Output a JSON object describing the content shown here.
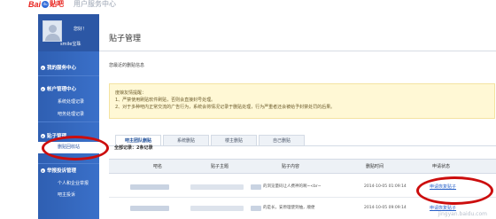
{
  "header": {
    "logo_bai": "Bai",
    "logo_paw": "du",
    "logo_tieba": "贴吧",
    "title": "用户服务中心"
  },
  "sidebar": {
    "hello": "您好！",
    "username": "smile宝珠",
    "sections": [
      {
        "label": "我的服务中心",
        "items": []
      },
      {
        "label": "帐户管理中心",
        "items": [
          "系统处理记录",
          "吧务处理记录"
        ]
      },
      {
        "label": "贴子管理",
        "items": [
          "删贴回收站"
        ]
      },
      {
        "label": "举报投诉管理",
        "items": [
          "个人和企业举报",
          "吧主投诉"
        ]
      }
    ],
    "active_item": "删贴回收站"
  },
  "main": {
    "title": "贴子管理",
    "subhead": "您最近的删贴信息",
    "notice": {
      "heading": "度娘友情提醒：",
      "line1": "1、严禁使用刷贴软件刷贴，否则会直接封号处理。",
      "line2": "2、对于多种吧内正常交流的广告行为，系统会将情况记录于删贴处理，行为严重者还会被给予封禁处罚的后果。"
    },
    "tabs": [
      "吧主团队删贴",
      "系统删贴",
      "楼主删贴",
      "自己删贴"
    ],
    "active_tab": "吧主团队删贴",
    "count_text": "全部记录：2条记录",
    "table": {
      "headers": [
        "吧名",
        "贴子主题",
        "贴子内容",
        "删贴时间",
        "申请状态"
      ],
      "rows": [
        {
          "content": "的浏览量码让人费神的啊~<br~",
          "time": "2014-10-05 01:09:14",
          "status": "申请恢复贴子"
        },
        {
          "content": "的是长，安原理使到抽，顺便",
          "time": "2014-10-05 09:09:14",
          "status": "申请恢复贴子"
        }
      ]
    }
  },
  "watermark": "jingyan.baidu.com",
  "colors": {
    "sidebar_bg": "#2f5fb2",
    "notice_bg": "#fff8d5",
    "highlight": "#cc0d0d",
    "link": "#2a62c9"
  }
}
